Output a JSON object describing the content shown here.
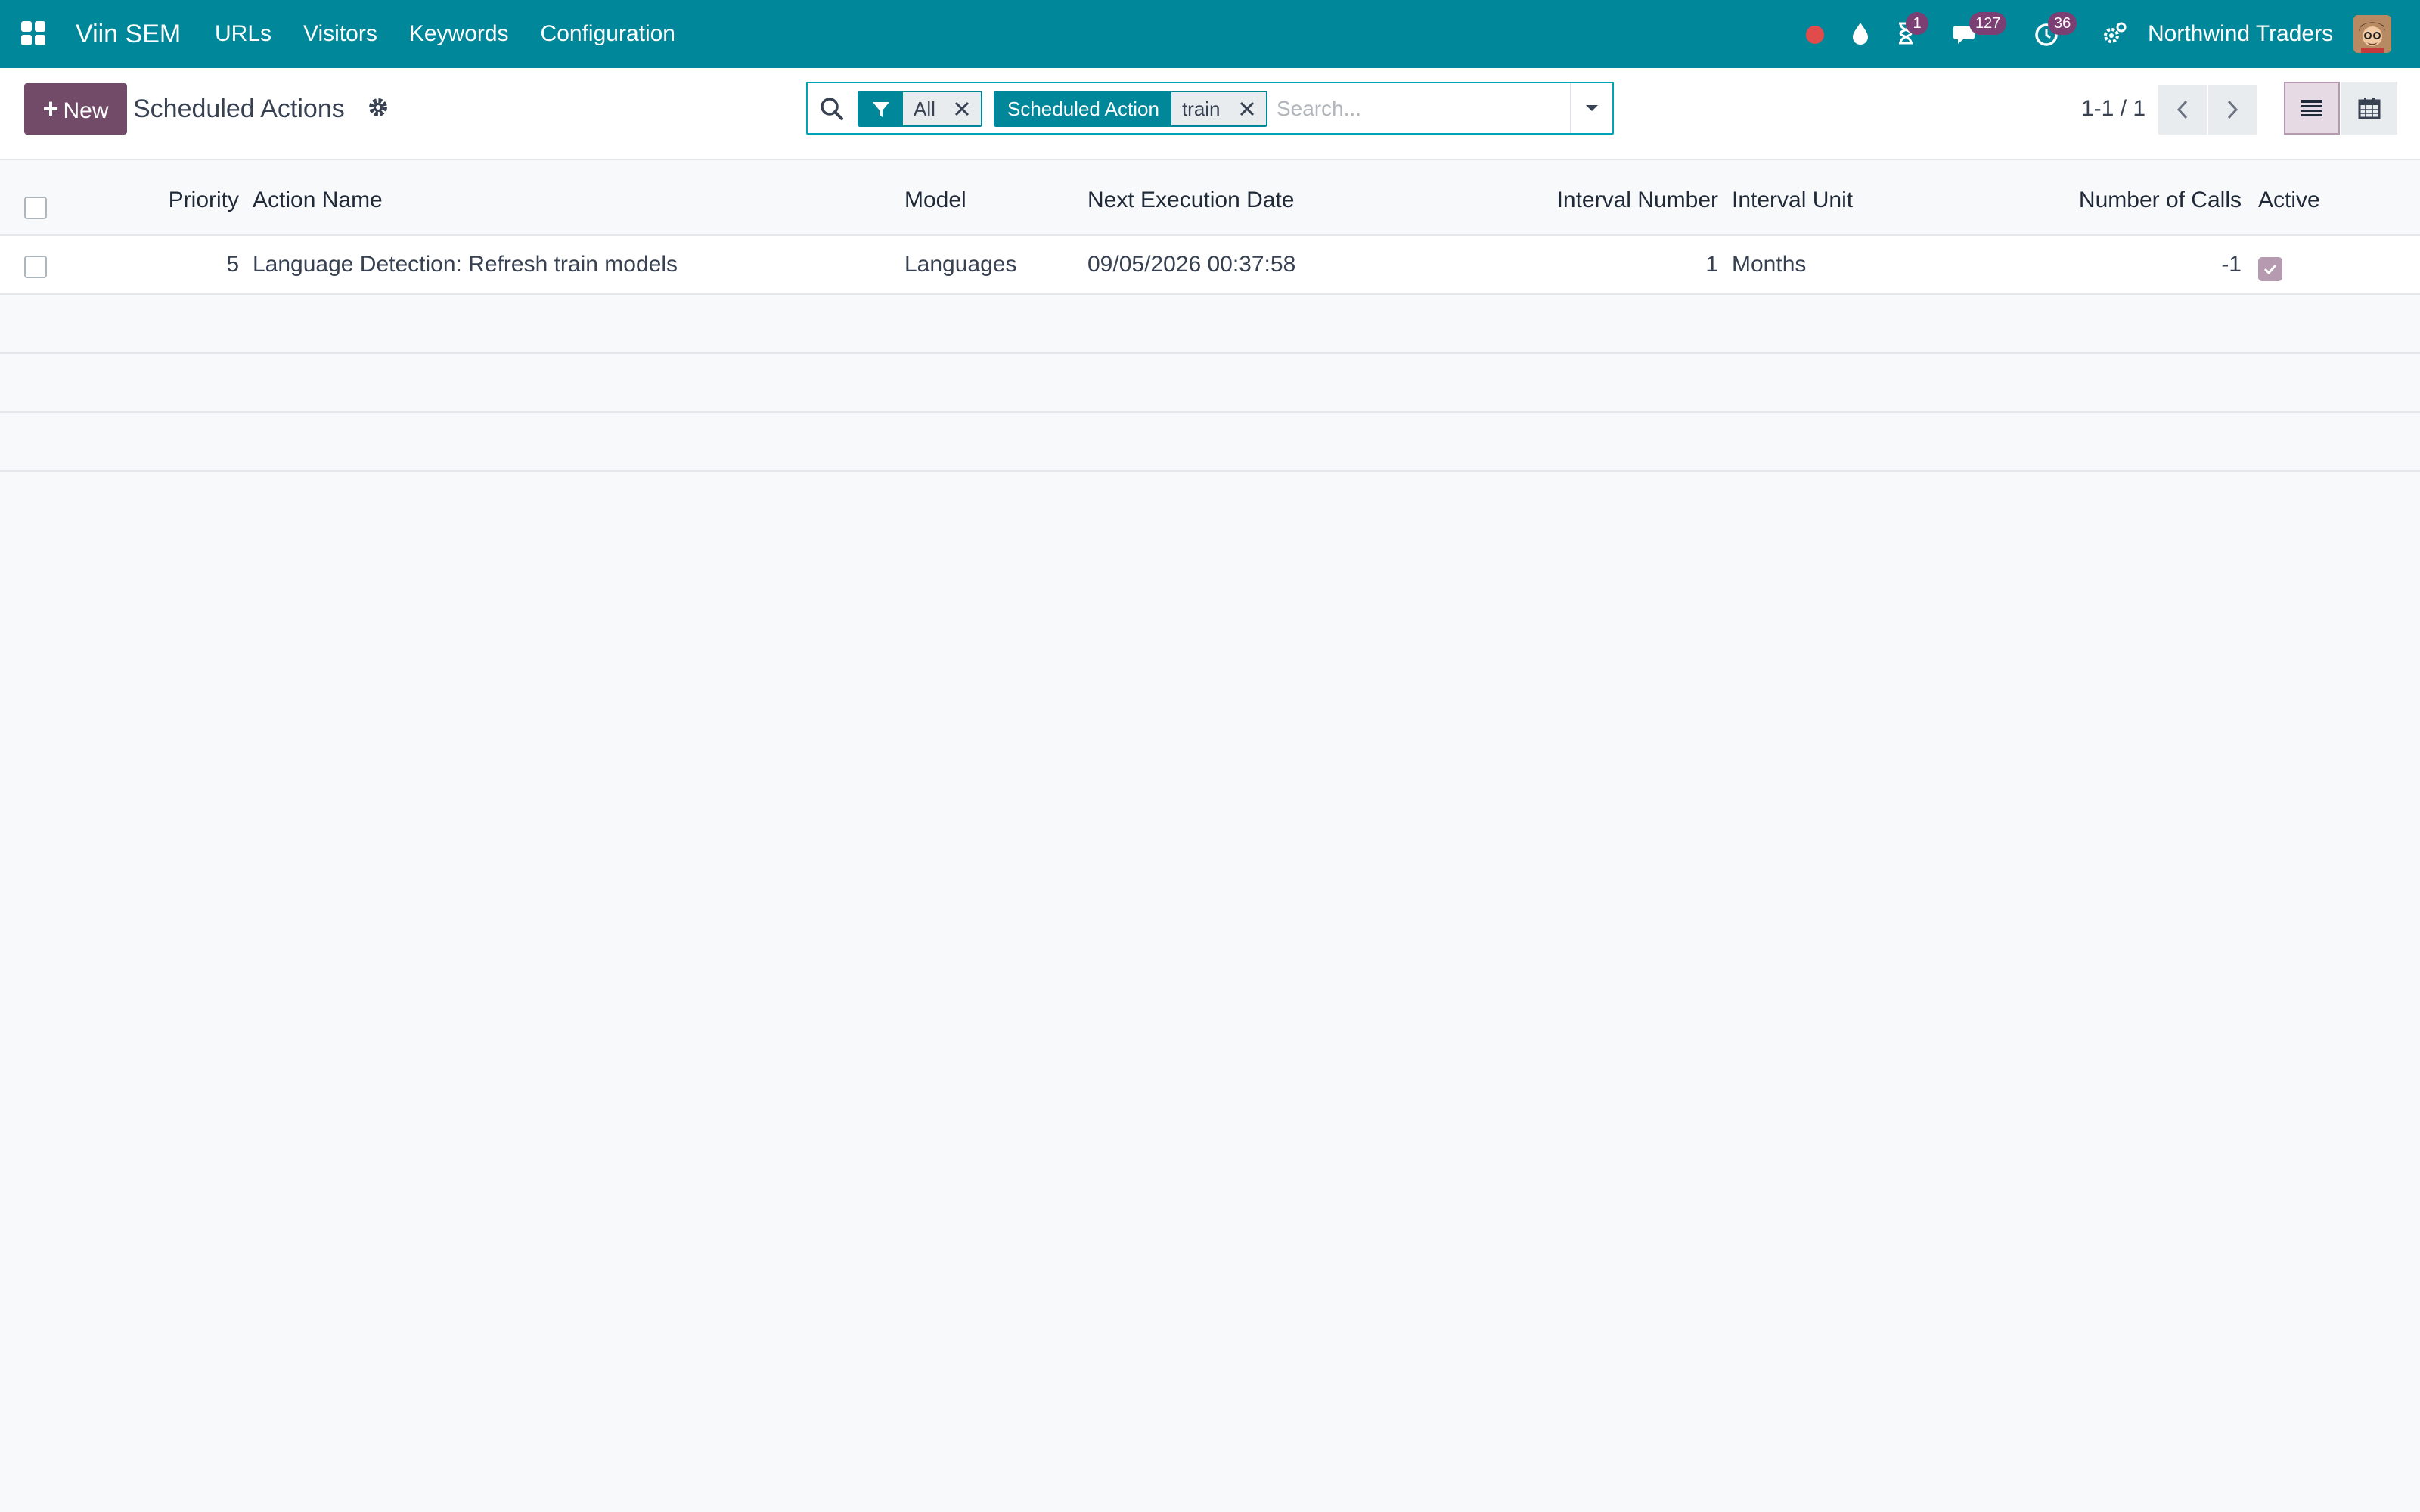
{
  "navbar": {
    "app_name": "Viin SEM",
    "menu": [
      "URLs",
      "Visitors",
      "Keywords",
      "Configuration"
    ],
    "activity_badge": "1",
    "messages_badge": "127",
    "timer_badge": "36",
    "company": "Northwind Traders"
  },
  "control_panel": {
    "new_label": "New",
    "title": "Scheduled Actions",
    "search": {
      "facets": [
        {
          "label_icon": "filter-icon",
          "value": "All"
        },
        {
          "label": "Scheduled Action",
          "value": "train"
        }
      ],
      "placeholder": "Search..."
    },
    "pager": "1-1 / 1"
  },
  "list": {
    "columns": [
      "Priority",
      "Action Name",
      "Model",
      "Next Execution Date",
      "Interval Number",
      "Interval Unit",
      "Number of Calls",
      "Active"
    ],
    "rows": [
      {
        "priority": "5",
        "action_name": "Language Detection: Refresh train models",
        "model": "Languages",
        "next_execution_date": "09/05/2026 00:37:58",
        "interval_number": "1",
        "interval_unit": "Months",
        "number_of_calls": "-1",
        "active": true
      }
    ]
  },
  "colors": {
    "navbar": "#00879a",
    "primary": "#714b67",
    "badge": "#7c3f73",
    "recording_dot": "#e04b4b"
  }
}
